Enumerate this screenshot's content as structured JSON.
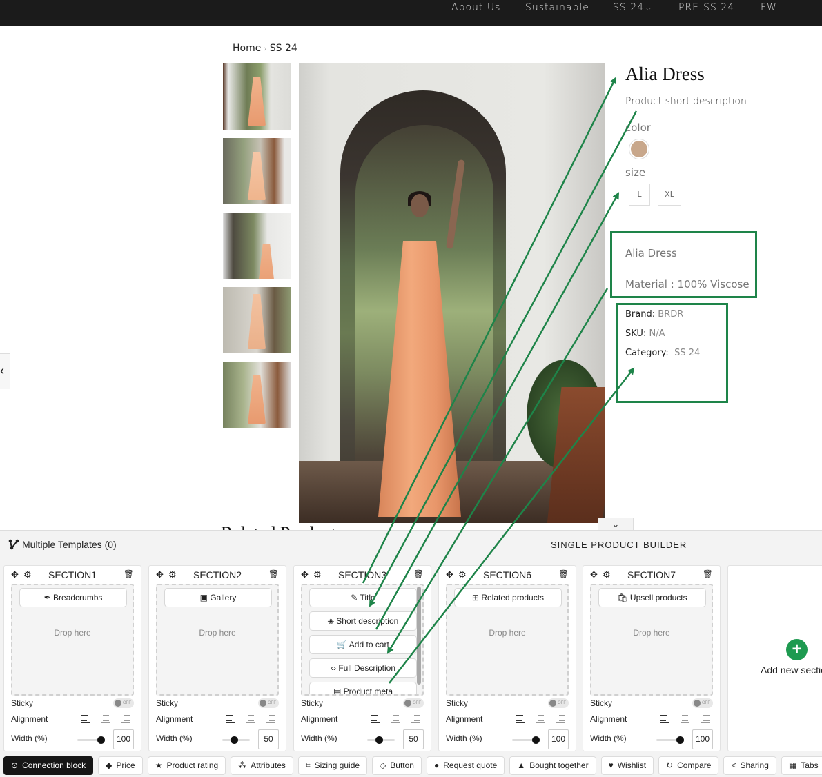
{
  "nav": {
    "items": [
      "About Us",
      "Sustainable",
      "SS 24",
      "PRE-SS 24",
      "FW"
    ],
    "dropdown_item_index": 2
  },
  "breadcrumb": {
    "home": "Home",
    "separator": "›",
    "current": "SS 24"
  },
  "gallery": {
    "thumbnail_count": 5,
    "slider_down_icon": "chevron-down-icon",
    "left_nav_icon": "chevron-left-icon"
  },
  "product": {
    "title": "Alia Dress",
    "short_description": "Product short description",
    "color_label": "color",
    "color_swatch": "#c8a78b",
    "size_label": "size",
    "sizes": [
      "L",
      "XL"
    ],
    "full_description": {
      "line1": "Alia Dress",
      "line2": "Material : 100% Viscose"
    },
    "meta": {
      "brand_label": "Brand:",
      "brand_value": "BRDR",
      "sku_label": "SKU:",
      "sku_value": "N/A",
      "category_label": "Category:",
      "category_value": "SS 24"
    }
  },
  "related_title": "Related Products",
  "builder": {
    "templates_label": "Multiple Templates (0)",
    "title": "SINGLE PRODUCT BUILDER",
    "drop_text": "Drop here",
    "sticky_label": "Sticky",
    "toggle_text": "OFF",
    "alignment_label": "Alignment",
    "width_label": "Width (%)",
    "sections": [
      {
        "name": "SECTION1",
        "blocks": [
          {
            "icon": "✒",
            "label": "Breadcrumbs"
          }
        ],
        "width": 100,
        "sticky": false
      },
      {
        "name": "SECTION2",
        "blocks": [
          {
            "icon": "▣",
            "label": "Gallery"
          }
        ],
        "width": 50,
        "sticky": false
      },
      {
        "name": "SECTION3",
        "blocks": [
          {
            "icon": "✎",
            "label": "Title"
          },
          {
            "icon": "◈",
            "label": "Short description"
          },
          {
            "icon": "🛒",
            "label": "Add to cart"
          },
          {
            "icon": "‹›",
            "label": "Full Description"
          },
          {
            "icon": "▤",
            "label": "Product meta"
          }
        ],
        "width": 50,
        "sticky": false
      },
      {
        "name": "SECTION6",
        "blocks": [
          {
            "icon": "⊞",
            "label": "Related products"
          }
        ],
        "width": 100,
        "sticky": false
      },
      {
        "name": "SECTION7",
        "blocks": [
          {
            "icon": "🛍",
            "label": "Upsell products"
          }
        ],
        "width": 100,
        "sticky": false
      }
    ],
    "add_new_label": "Add new section",
    "chips": [
      {
        "icon": "⊙",
        "label": "Connection block",
        "active": true
      },
      {
        "icon": "◆",
        "label": "Price"
      },
      {
        "icon": "★",
        "label": "Product rating"
      },
      {
        "icon": "⁂",
        "label": "Attributes"
      },
      {
        "icon": "⌗",
        "label": "Sizing guide"
      },
      {
        "icon": "◇",
        "label": "Button"
      },
      {
        "icon": "●",
        "label": "Request quote"
      },
      {
        "icon": "▲",
        "label": "Bought together"
      },
      {
        "icon": "♥",
        "label": "Wishlist"
      },
      {
        "icon": "↻",
        "label": "Compare"
      },
      {
        "icon": "<",
        "label": "Sharing"
      },
      {
        "icon": "▦",
        "label": "Tabs"
      }
    ]
  },
  "colors": {
    "annotation_green": "#1e8449",
    "add_button_green": "#1e9a50",
    "nav_bg": "#1b1b1b"
  }
}
